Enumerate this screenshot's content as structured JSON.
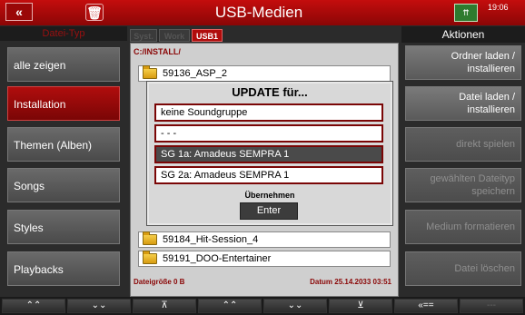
{
  "titlebar": {
    "back_icon": "double-chevron-left-icon",
    "back_glyph": "«",
    "trash_icon": "trash-icon",
    "trash_glyph": "🗑",
    "title": "USB-Medien",
    "keyboard_icon": "keyboard-icon",
    "keyboard_glyph": "⇈",
    "clock": "19:06"
  },
  "left": {
    "header": "Datei-Typ",
    "items": [
      {
        "label": "alle zeigen",
        "active": false
      },
      {
        "label": "Installation",
        "active": true
      },
      {
        "label": "Themen (Alben)",
        "active": false
      },
      {
        "label": "Songs",
        "active": false
      },
      {
        "label": "Styles",
        "active": false
      },
      {
        "label": "Playbacks",
        "active": false
      }
    ]
  },
  "tabs": [
    {
      "label": "Syst.",
      "active": false
    },
    {
      "label": "Work",
      "active": false
    },
    {
      "label": "USB1",
      "active": true
    }
  ],
  "browser": {
    "path": "C:/INSTALL/",
    "files": [
      "59136_ASP_2",
      "59184_Hit-Session_4",
      "59191_DOO-Entertainer"
    ],
    "file_size_label": "Dateigröße 0 B",
    "date_label": "Datum 25.14.2033 03:51"
  },
  "dialog": {
    "title": "UPDATE für...",
    "options": [
      {
        "label": "keine Soundgruppe",
        "selected": false
      },
      {
        "label": "- - -",
        "selected": false
      },
      {
        "label": "SG 1a: Amadeus SEMPRA 1",
        "selected": true
      },
      {
        "label": "SG 2a: Amadeus SEMPRA 1",
        "selected": false
      }
    ],
    "apply_label": "Übernehmen",
    "enter_label": "Enter"
  },
  "right": {
    "header": "Aktionen",
    "items": [
      {
        "line1": "Ordner laden /",
        "line2": "installieren",
        "disabled": false
      },
      {
        "line1": "Datei laden /",
        "line2": "installieren",
        "disabled": false
      },
      {
        "line1": "direkt spielen",
        "line2": "",
        "disabled": true
      },
      {
        "line1": "gewählten Dateityp",
        "line2": "speichern",
        "disabled": true
      },
      {
        "line1": "Medium formatieren",
        "line2": "",
        "disabled": true
      },
      {
        "line1": "Datei löschen",
        "line2": "",
        "disabled": true
      }
    ]
  },
  "bottom": {
    "buttons": [
      {
        "icon": "double-chevron-up-icon",
        "glyph": "⌃⌃"
      },
      {
        "icon": "double-chevron-down-icon",
        "glyph": "⌄⌄"
      },
      {
        "icon": "chevron-up-bar-icon",
        "glyph": "⊼"
      },
      {
        "icon": "double-chevron-up-icon",
        "glyph": "⌃⌃"
      },
      {
        "icon": "double-chevron-down-icon",
        "glyph": "⌄⌄"
      },
      {
        "icon": "chevron-down-bar-icon",
        "glyph": "⊻"
      },
      {
        "icon": "back-arrow-icon",
        "glyph": "«=="
      },
      {
        "icon": "empty-icon",
        "glyph": "---"
      }
    ]
  },
  "colors": {
    "accent": "#b00c0c",
    "panel": "#cfcfcf",
    "dark": "#2b2b2b"
  }
}
